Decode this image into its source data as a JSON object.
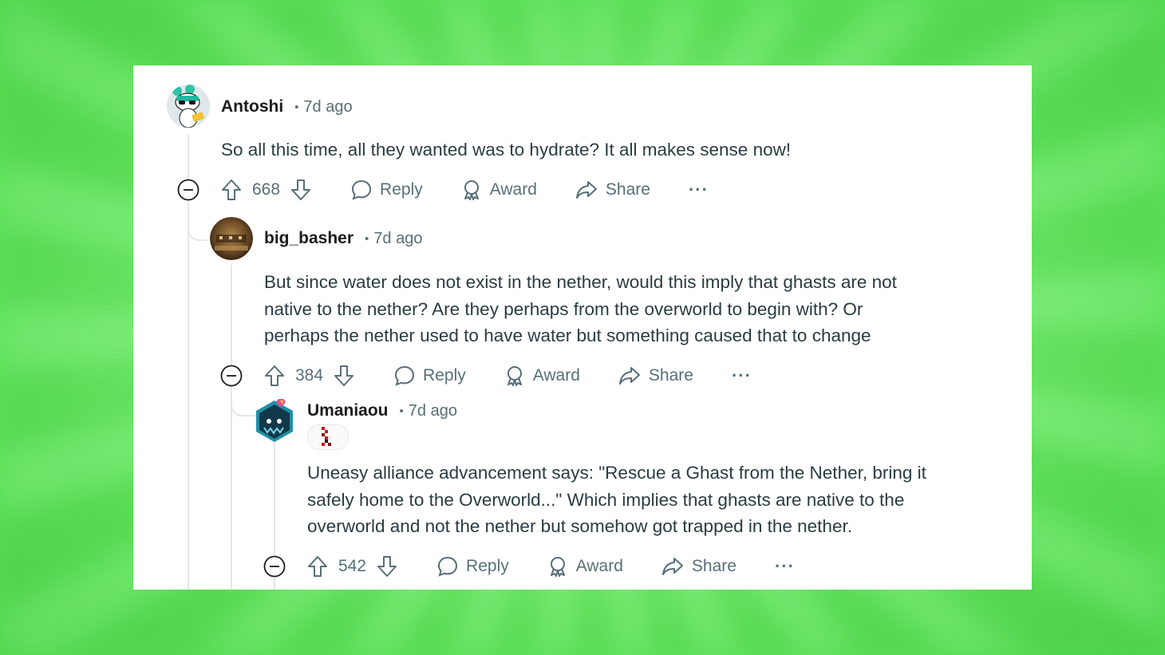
{
  "comments": [
    {
      "author": "Antoshi",
      "separator": "•",
      "time": "7d ago",
      "body": "So all this time, all they wanted was to hydrate? It all makes sense now!",
      "score": "668",
      "avatar_icon": "snoo-avatar-icon"
    },
    {
      "author": "big_basher",
      "separator": "•",
      "time": "7d ago",
      "body_lines": [
        "But since water does not exist in the nether, would this imply that ghasts are not",
        "native to the nether? Are they perhaps from the overworld to begin with? Or",
        "perhaps the nether used to have water but something caused that to change"
      ],
      "score": "384",
      "avatar_icon": "photo-avatar-icon"
    },
    {
      "author": "Umaniaou",
      "separator": "•",
      "time": "7d ago",
      "body_lines": [
        "Uneasy alliance advancement says: \"Rescue a Ghast from the Nether, bring it",
        "safely home to the Overworld...\" Which implies that ghasts are native to the",
        "overworld and not the nether but somehow got trapped in the nether."
      ],
      "score": "542",
      "avatar_icon": "nft-avatar-icon",
      "flair_icon": "pixel-flair-icon"
    }
  ],
  "actions": {
    "reply": "Reply",
    "award": "Award",
    "share": "Share",
    "more": "···"
  },
  "colors": {
    "background": "#6ee86a",
    "card": "#ffffff",
    "text": "#2a3c42",
    "meta": "#576f76"
  }
}
